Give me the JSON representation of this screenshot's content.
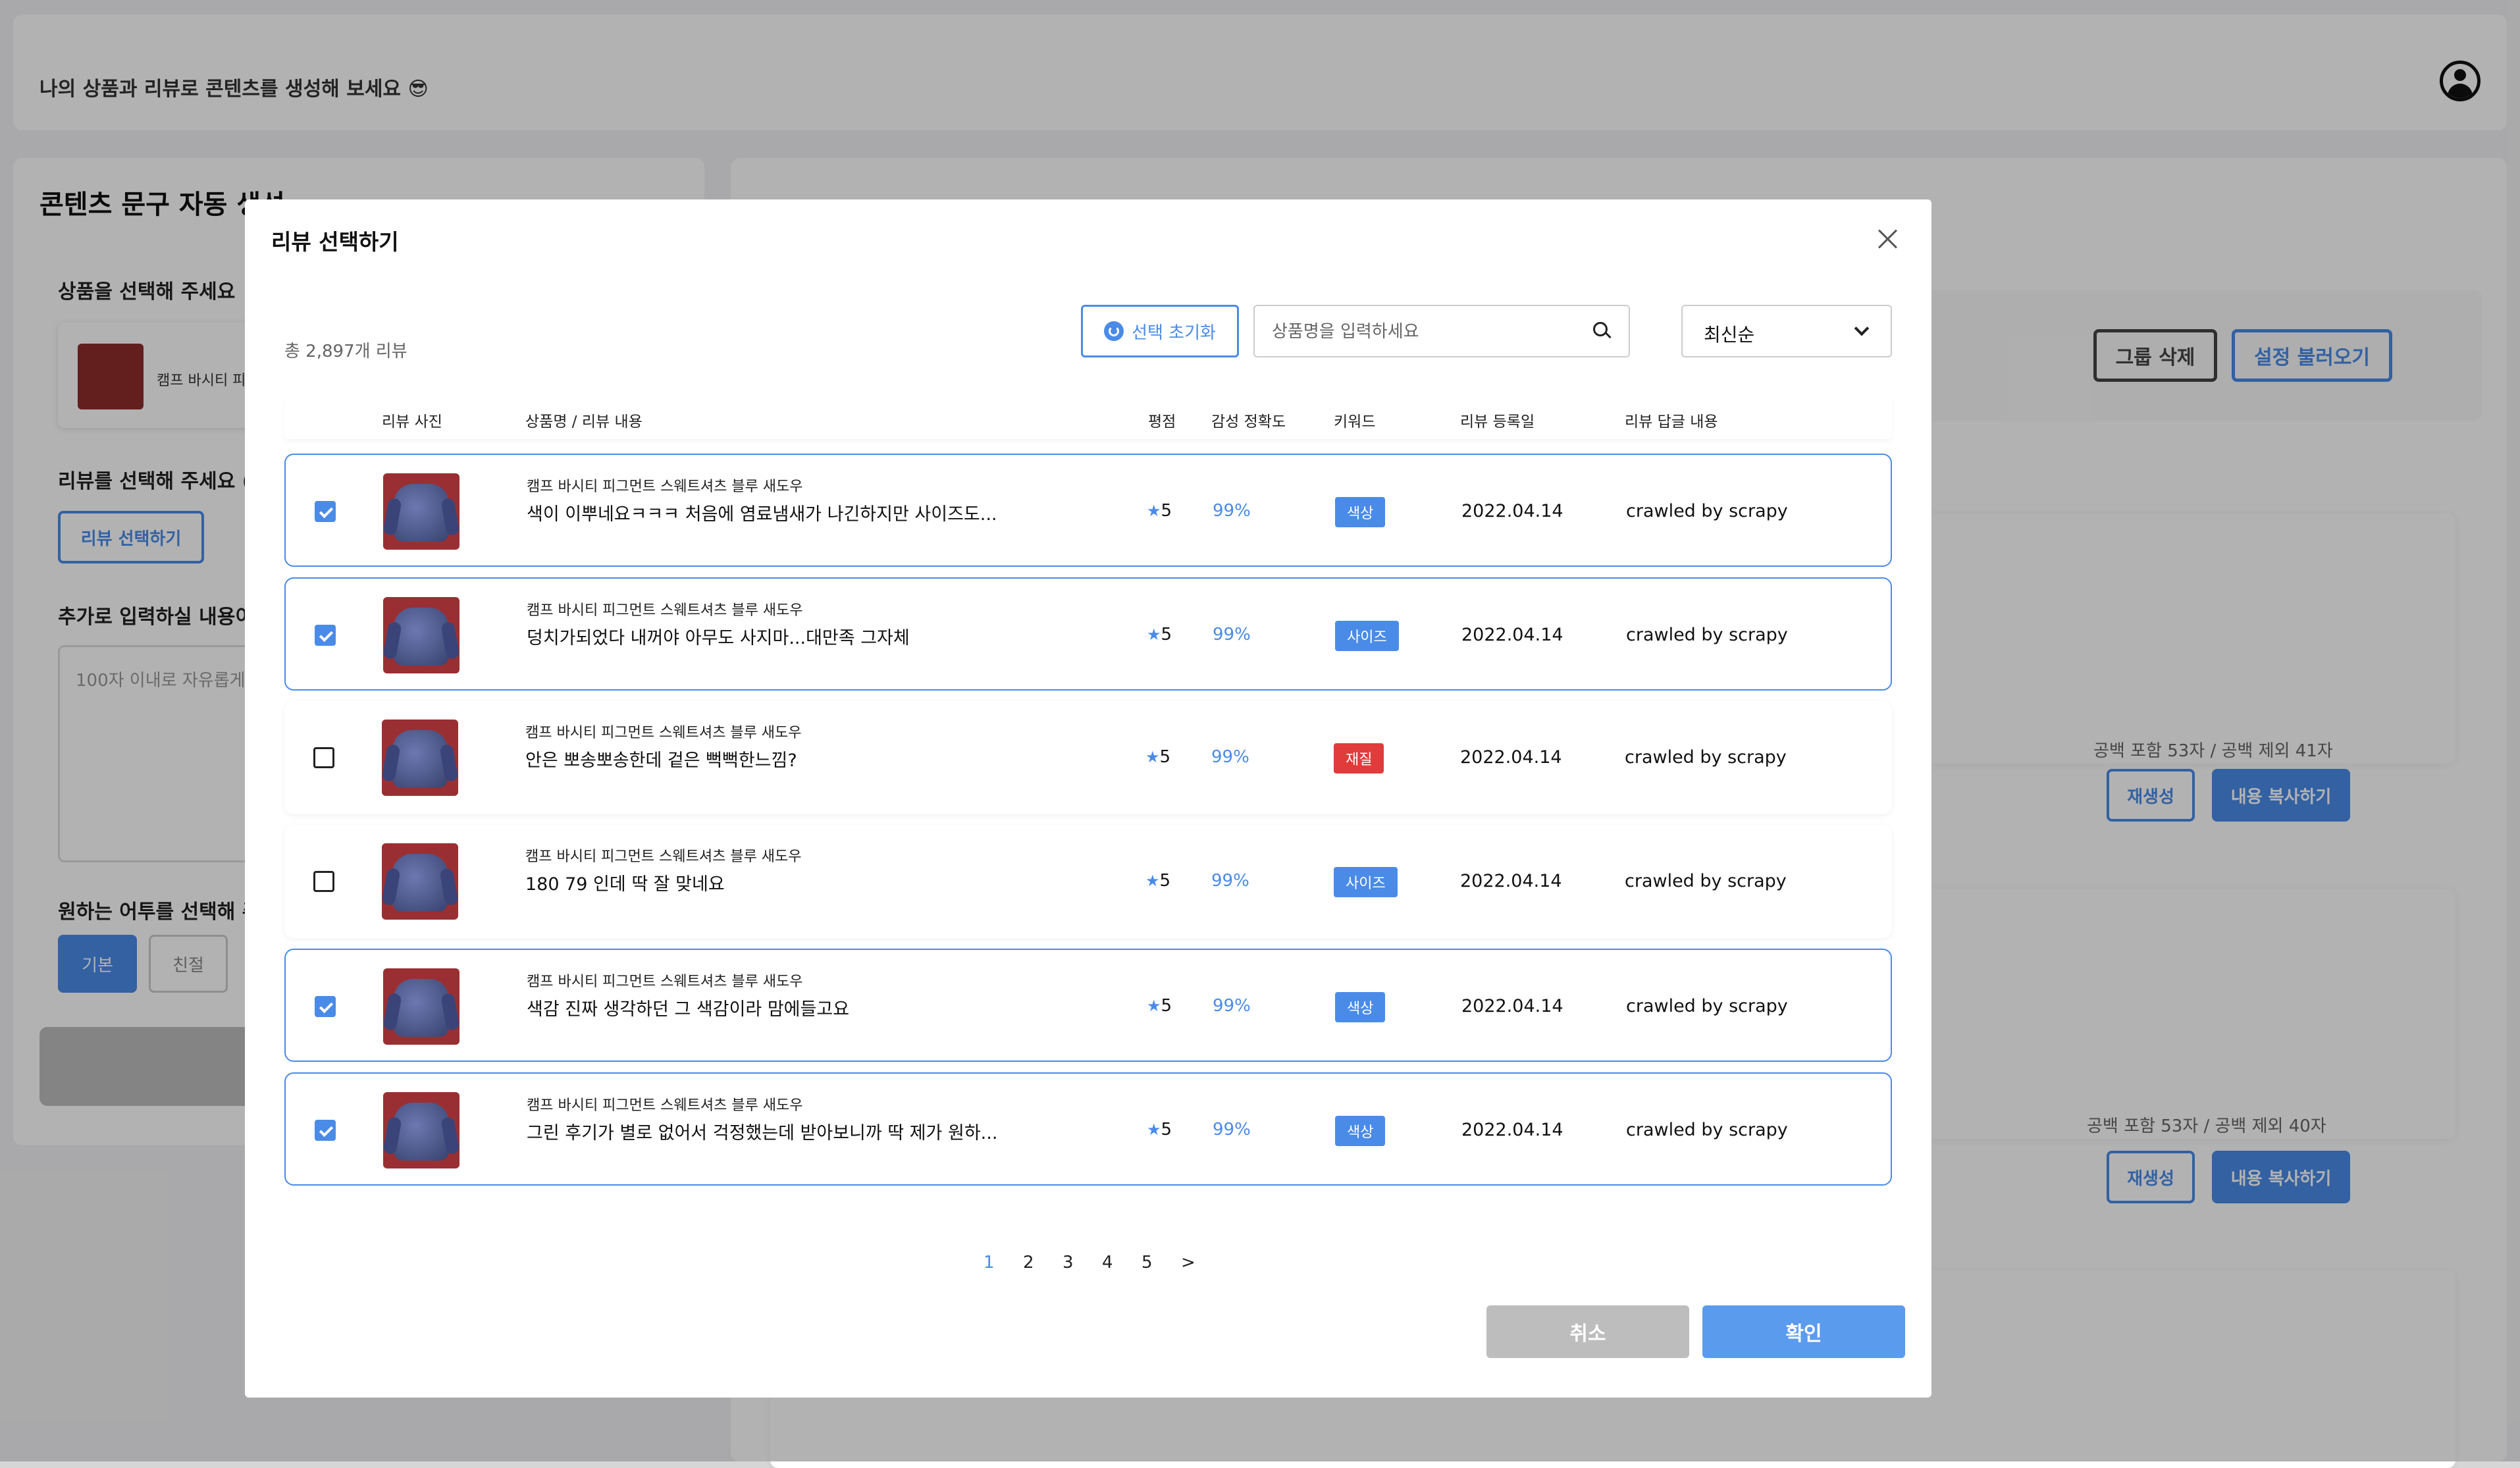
{
  "background": {
    "welcome": "나의 상품과 리뷰로 콘텐츠를 생성해 보세요 😎",
    "left_panel": {
      "title": "콘텐츠 문구 자동 생성",
      "product_label": "상품을 선택해 주세요",
      "product_name": "캠프 바시티 피",
      "review_label": "리뷰를 선택해 주세요 (",
      "review_button": "리뷰 선택하기",
      "extra_label": "추가로 입력하실 내용이",
      "extra_placeholder": "100자 이내로 자유롭게",
      "tone_label": "원하는 어투를 선택해 주",
      "tones": [
        "기본",
        "친절"
      ]
    },
    "right_panel": {
      "group_delete": "그룹 삭제",
      "load_settings": "설정 불러오기",
      "count1": "공백 포함 53자 / 공백 제외 41자",
      "count2": "공백 포함 53자 / 공백 제외 40자",
      "regenerate": "재생성",
      "copy": "내용 복사하기"
    }
  },
  "modal": {
    "title": "리뷰 선택하기",
    "total": "총 2,897개 리뷰",
    "reset_label": "선택 초기화",
    "search_placeholder": "상품명을 입력하세요",
    "sort_value": "최신순",
    "columns": {
      "photo": "리뷰 사진",
      "name": "상품명 / 리뷰 내용",
      "rating": "평점",
      "accuracy": "감성 정확도",
      "keyword": "키워드",
      "date": "리뷰 등록일",
      "reply": "리뷰 답글 내용"
    },
    "rows": [
      {
        "selected": true,
        "product": "캠프 바시티 피그먼트 스웨트셔츠 블루 새도우",
        "content": "색이 이뿌네요ㅋㅋㅋ 처음에 염료냄새가 나긴하지만 사이즈도...",
        "rating": "5",
        "accuracy": "99%",
        "keyword": "색상",
        "keyword_color": "#4a8be8",
        "date": "2022.04.14",
        "reply": "crawled by scrapy"
      },
      {
        "selected": true,
        "product": "캠프 바시티 피그먼트 스웨트셔츠 블루 새도우",
        "content": "덩치가되었다 내꺼야 아무도 사지마...대만족 그자체",
        "rating": "5",
        "accuracy": "99%",
        "keyword": "사이즈",
        "keyword_color": "#4a8be8",
        "date": "2022.04.14",
        "reply": "crawled by scrapy"
      },
      {
        "selected": false,
        "product": "캠프 바시티 피그먼트 스웨트셔츠 블루 새도우",
        "content": "안은 뽀송뽀송한데 겉은 뻑뻑한느낌?",
        "rating": "5",
        "accuracy": "99%",
        "keyword": "재질",
        "keyword_color": "#e23b3b",
        "date": "2022.04.14",
        "reply": "crawled by scrapy"
      },
      {
        "selected": false,
        "product": "캠프 바시티 피그먼트 스웨트셔츠 블루 새도우",
        "content": "180 79 인데 딱 잘 맞네요",
        "rating": "5",
        "accuracy": "99%",
        "keyword": "사이즈",
        "keyword_color": "#4a8be8",
        "date": "2022.04.14",
        "reply": "crawled by scrapy"
      },
      {
        "selected": true,
        "product": "캠프 바시티 피그먼트 스웨트셔츠 블루 새도우",
        "content": "색감 진짜 생각하던 그 색감이라 맘에들고요",
        "rating": "5",
        "accuracy": "99%",
        "keyword": "색상",
        "keyword_color": "#4a8be8",
        "date": "2022.04.14",
        "reply": "crawled by scrapy"
      },
      {
        "selected": true,
        "product": "캠프 바시티 피그먼트 스웨트셔츠 블루 새도우",
        "content": "그린 후기가 별로 없어서 걱정했는데 받아보니까 딱 제가 원하...",
        "rating": "5",
        "accuracy": "99%",
        "keyword": "색상",
        "keyword_color": "#4a8be8",
        "date": "2022.04.14",
        "reply": "crawled by scrapy"
      }
    ],
    "pagination": {
      "pages": [
        "1",
        "2",
        "3",
        "4",
        "5"
      ],
      "next": ">",
      "current": "1"
    },
    "cancel_label": "취소",
    "confirm_label": "확인"
  }
}
